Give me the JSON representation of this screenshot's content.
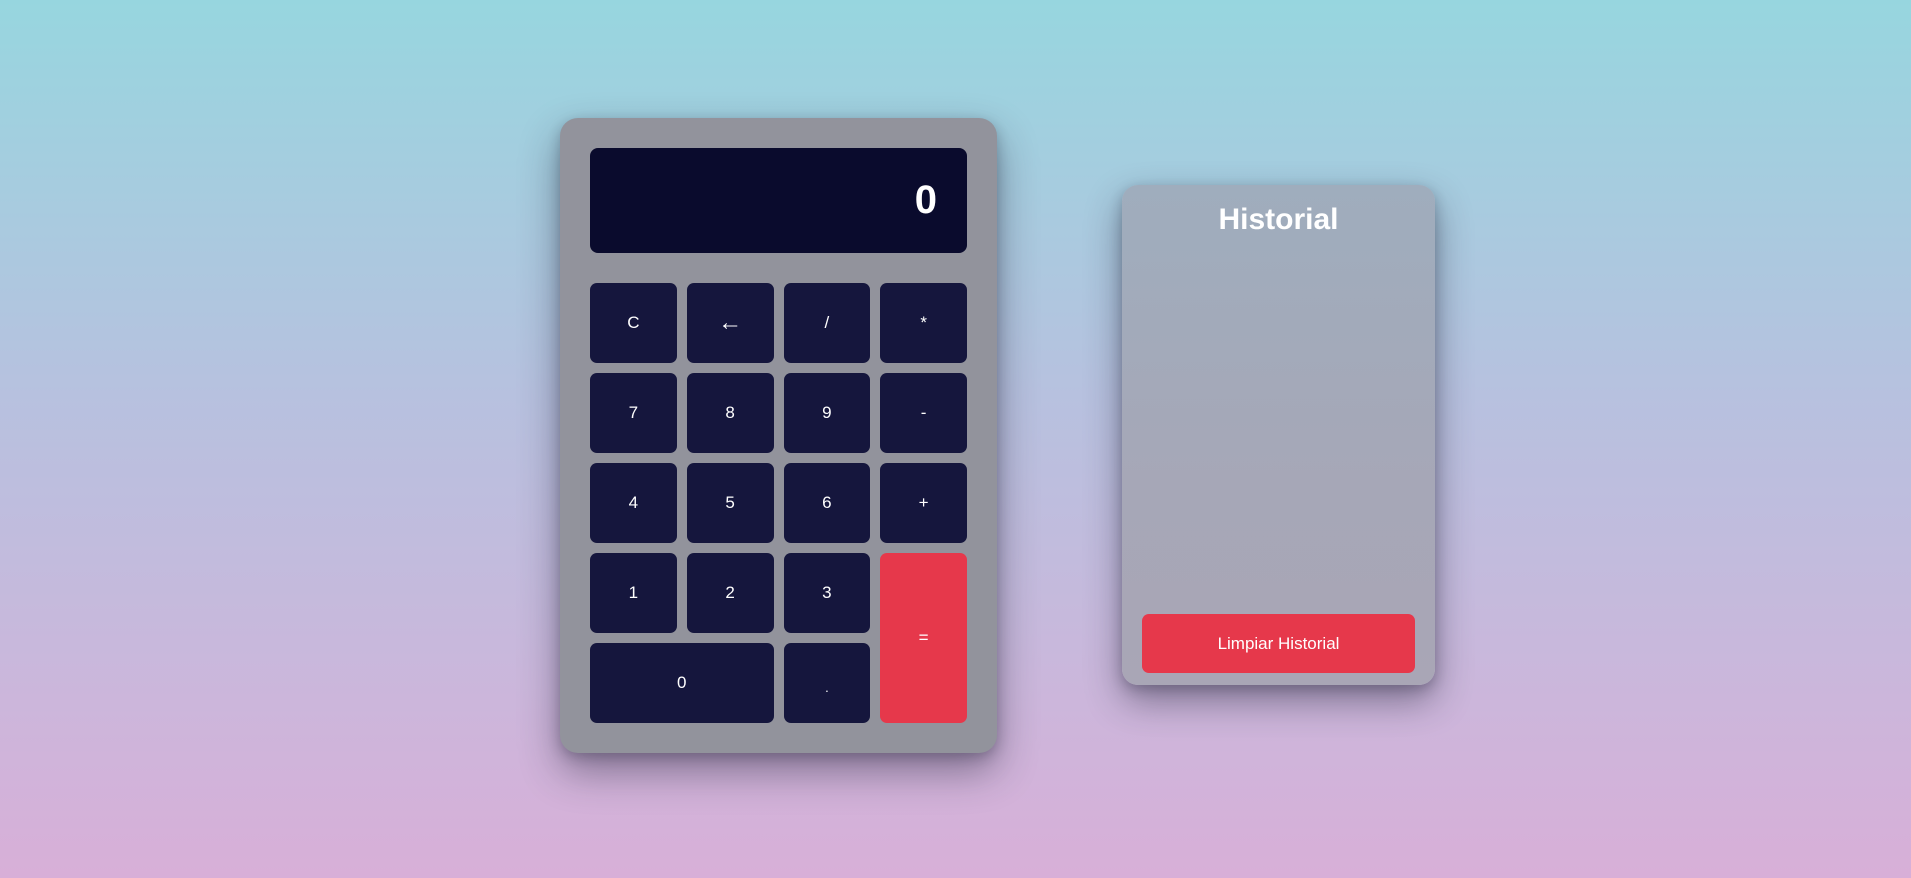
{
  "calculator": {
    "display_value": "0",
    "keys": {
      "clear": "C",
      "backspace": "←",
      "divide": "/",
      "multiply": "*",
      "seven": "7",
      "eight": "8",
      "nine": "9",
      "subtract": "-",
      "four": "4",
      "five": "5",
      "six": "6",
      "add": "+",
      "one": "1",
      "two": "2",
      "three": "3",
      "equals": "=",
      "zero": "0",
      "decimal": "."
    }
  },
  "history": {
    "title": "Historial",
    "entries": [],
    "clear_label": "Limpiar Historial"
  },
  "colors": {
    "accent": "#e6384b",
    "key_background": "#15163d",
    "display_background": "#0a0b2d",
    "calculator_body": "#92939c"
  }
}
